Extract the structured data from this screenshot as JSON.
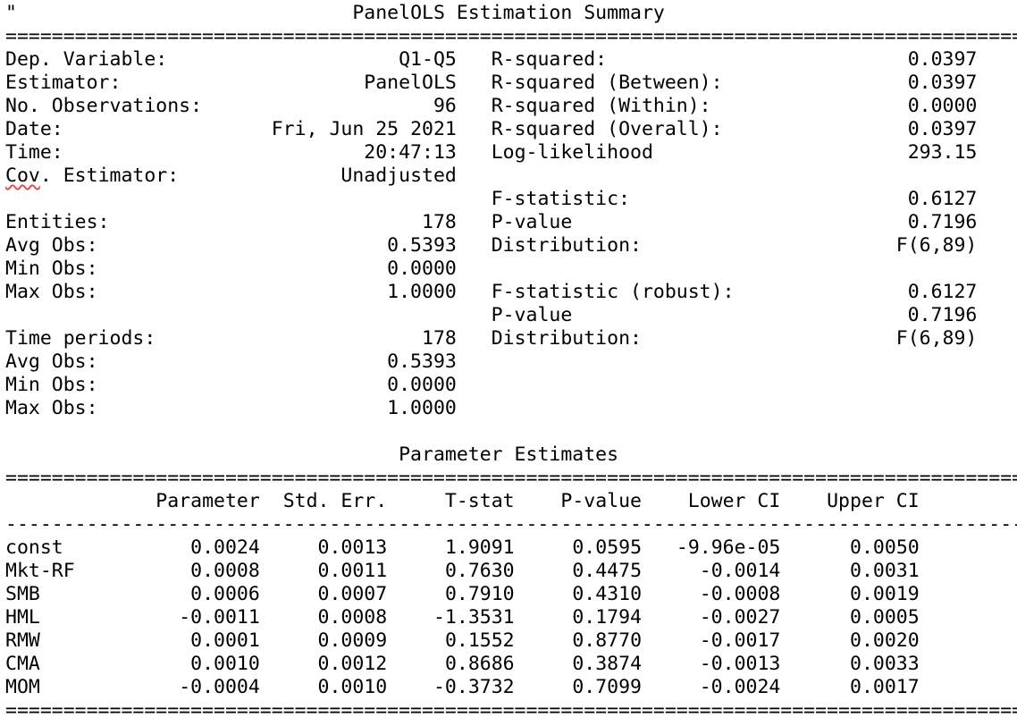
{
  "quote_mark": "\"",
  "summary": {
    "title": "PanelOLS Estimation Summary",
    "double_rule": "=========================================================================================",
    "left": [
      {
        "label": "Dep. Variable:",
        "value": "Q1-Q5"
      },
      {
        "label": "Estimator:",
        "value": "PanelOLS"
      },
      {
        "label": "No. Observations:",
        "value": "96"
      },
      {
        "label": "Date:",
        "value": "Fri, Jun 25 2021"
      },
      {
        "label": "Time:",
        "value": "20:47:13"
      },
      {
        "label": "Cov. Estimator:",
        "value": "Unadjusted"
      },
      {
        "label": "",
        "value": ""
      },
      {
        "label": "Entities:",
        "value": "178"
      },
      {
        "label": "Avg Obs:",
        "value": "0.5393"
      },
      {
        "label": "Min Obs:",
        "value": "0.0000"
      },
      {
        "label": "Max Obs:",
        "value": "1.0000"
      },
      {
        "label": "",
        "value": ""
      },
      {
        "label": "Time periods:",
        "value": "178"
      },
      {
        "label": "Avg Obs:",
        "value": "0.5393"
      },
      {
        "label": "Min Obs:",
        "value": "0.0000"
      },
      {
        "label": "Max Obs:",
        "value": "1.0000"
      }
    ],
    "right": [
      {
        "label": "R-squared:",
        "value": "0.0397"
      },
      {
        "label": "R-squared (Between):",
        "value": "0.0397"
      },
      {
        "label": "R-squared (Within):",
        "value": "0.0000"
      },
      {
        "label": "R-squared (Overall):",
        "value": "0.0397"
      },
      {
        "label": "Log-likelihood",
        "value": "293.15"
      },
      {
        "label": "",
        "value": ""
      },
      {
        "label": "F-statistic:",
        "value": "0.6127"
      },
      {
        "label": "P-value",
        "value": "0.7196"
      },
      {
        "label": "Distribution:",
        "value": "F(6,89)"
      },
      {
        "label": "",
        "value": ""
      },
      {
        "label": "F-statistic (robust):",
        "value": "0.6127"
      },
      {
        "label": "P-value",
        "value": "0.7196"
      },
      {
        "label": "Distribution:",
        "value": "F(6,89)"
      }
    ]
  },
  "params": {
    "title": "Parameter Estimates",
    "double_rule": "========================================================================================",
    "single_rule": "----------------------------------------------------------------------------------------",
    "headers": [
      "",
      "Parameter",
      "Std. Err.",
      "T-stat",
      "P-value",
      "Lower CI",
      "Upper CI"
    ],
    "rows": [
      [
        "const",
        "0.0024",
        "0.0013",
        "1.9091",
        "0.0595",
        "-9.96e-05",
        "0.0050"
      ],
      [
        "Mkt-RF",
        "0.0008",
        "0.0011",
        "0.7630",
        "0.4475",
        "-0.0014",
        "0.0031"
      ],
      [
        "SMB",
        "0.0006",
        "0.0007",
        "0.7910",
        "0.4310",
        "-0.0008",
        "0.0019"
      ],
      [
        "HML",
        "-0.0011",
        "0.0008",
        "-1.3531",
        "0.1794",
        "-0.0027",
        "0.0005"
      ],
      [
        "RMW",
        "0.0001",
        "0.0009",
        "0.1552",
        "0.8770",
        "-0.0017",
        "0.0020"
      ],
      [
        "CMA",
        "0.0010",
        "0.0012",
        "0.8686",
        "0.3874",
        "-0.0013",
        "0.0033"
      ],
      [
        "MOM",
        "-0.0004",
        "0.0010",
        "-0.3732",
        "0.7099",
        "-0.0024",
        "0.0017"
      ]
    ]
  }
}
